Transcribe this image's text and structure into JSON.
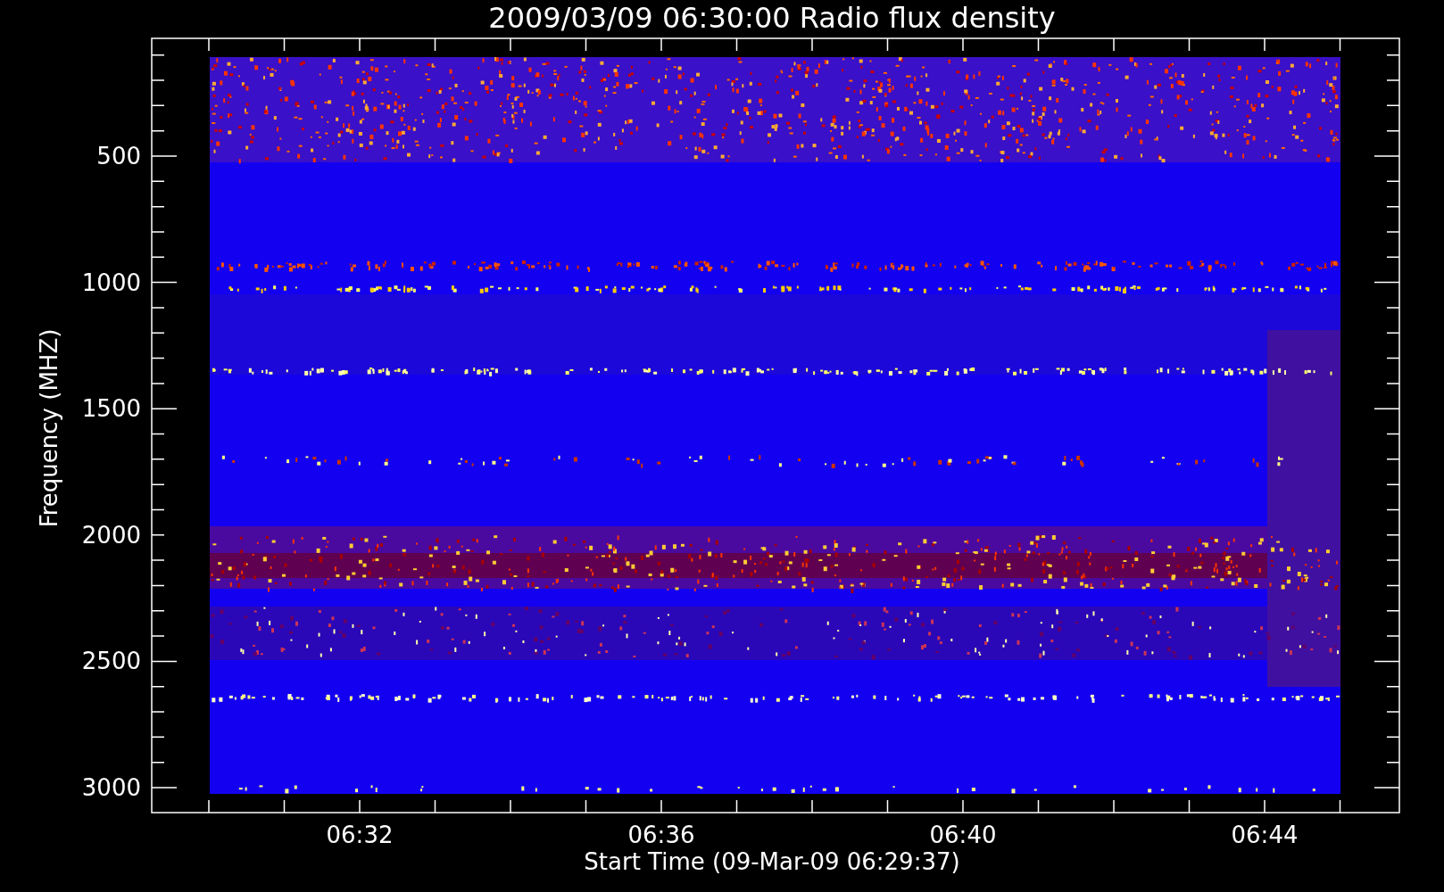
{
  "chart": {
    "title": "2009/03/09 06:30:00 Radio flux density",
    "ylabel": "Frequency (MHZ)",
    "xlabel": "Start Time (09-Mar-09 06:29:37)",
    "yticks": [
      "500",
      "1000",
      "1500",
      "2000",
      "2500",
      "3000"
    ],
    "xticks": [
      "06:32",
      "06:36",
      "06:40",
      "06:44"
    ]
  }
}
